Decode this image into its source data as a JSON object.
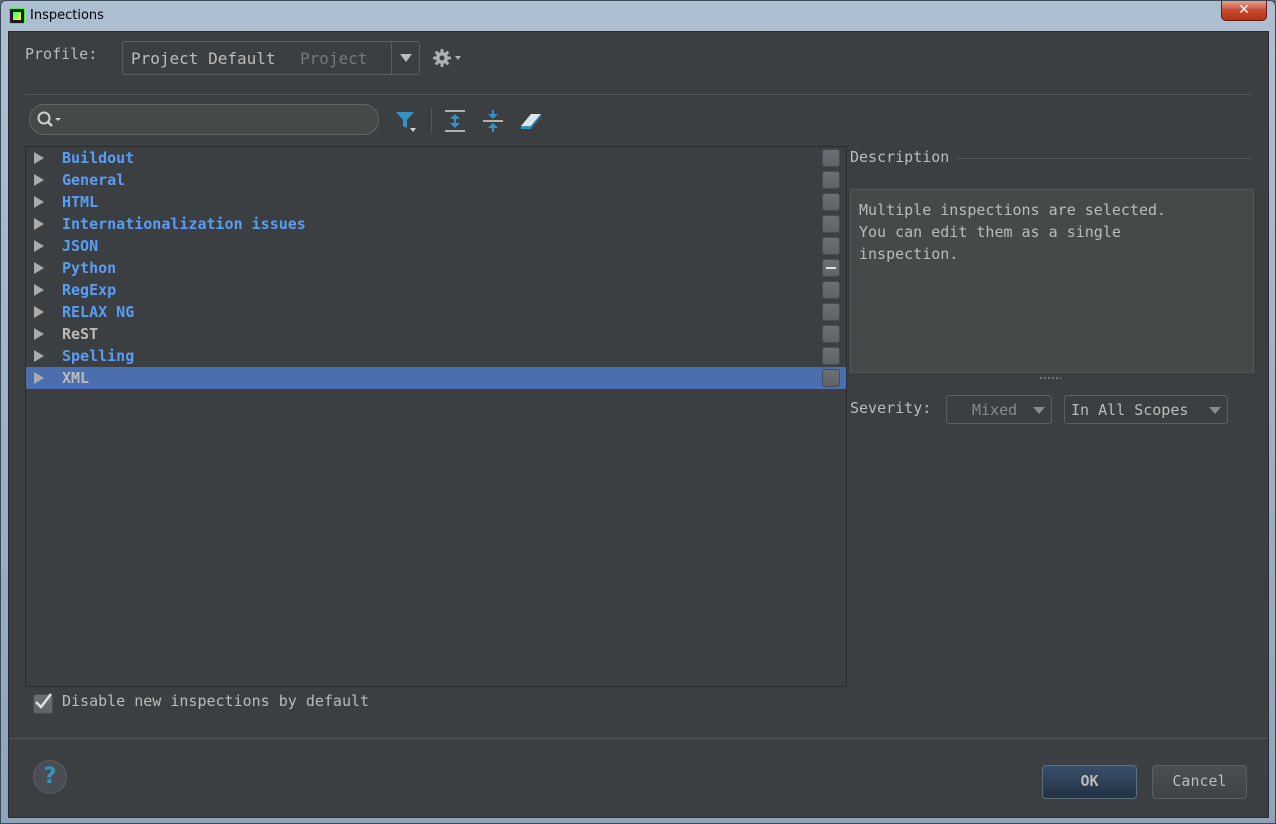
{
  "window": {
    "title": "Inspections",
    "close_label": "✕"
  },
  "profile": {
    "label": "Profile:",
    "value": "Project Default",
    "scope": "Project"
  },
  "search": {
    "value": "",
    "placeholder": ""
  },
  "toolbar": {
    "icons": [
      "filter-icon",
      "expand-all-icon",
      "collapse-all-icon",
      "reset-eraser-icon"
    ]
  },
  "tree": {
    "items": [
      {
        "label": "Buildout",
        "state": "unchecked"
      },
      {
        "label": "General",
        "state": "unchecked"
      },
      {
        "label": "HTML",
        "state": "unchecked"
      },
      {
        "label": "Internationalization issues",
        "state": "unchecked"
      },
      {
        "label": "JSON",
        "state": "unchecked"
      },
      {
        "label": "Python",
        "state": "mixed"
      },
      {
        "label": "RegExp",
        "state": "unchecked"
      },
      {
        "label": "RELAX NG",
        "state": "unchecked"
      },
      {
        "label": "ReST",
        "state": "unchecked"
      },
      {
        "label": "Spelling",
        "state": "unchecked"
      },
      {
        "label": "XML",
        "state": "unchecked"
      }
    ],
    "selected": "XML"
  },
  "description": {
    "label": "Description",
    "text": "Multiple inspections are selected.\nYou can edit them as a single\ninspection."
  },
  "severity": {
    "label": "Severity:",
    "value": "Mixed",
    "scope": "In All Scopes"
  },
  "options": {
    "disable_new_label": "Disable new inspections by default",
    "disable_new_checked": true
  },
  "buttons": {
    "help": "?",
    "ok": "OK",
    "cancel": "Cancel"
  },
  "colors": {
    "background": "#3c3f41",
    "link_blue": "#589df6",
    "selection": "#4b6eaf",
    "icon_blue": "#3592c4"
  }
}
